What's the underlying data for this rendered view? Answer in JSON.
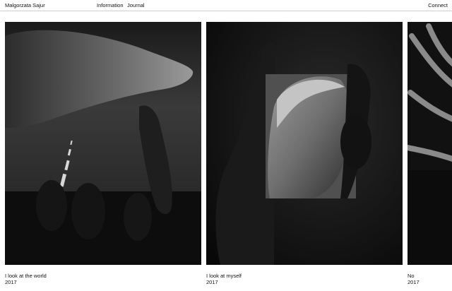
{
  "header": {
    "site_title": "Malgorzata Sajur",
    "nav": {
      "information": "Information",
      "journal": "Journal",
      "connect": "Connect"
    }
  },
  "projects": [
    {
      "title": "I look at the world",
      "year": "2017",
      "image_icon": "hand-road-photo"
    },
    {
      "title": "I look at myself",
      "year": "2017",
      "image_icon": "hands-mirror-photo"
    },
    {
      "title": "No",
      "year": "2017",
      "image_icon": "fingers-photo"
    }
  ],
  "colors": {
    "background": "#ffffff",
    "text": "#111111",
    "divider": "#cfcfcf"
  }
}
